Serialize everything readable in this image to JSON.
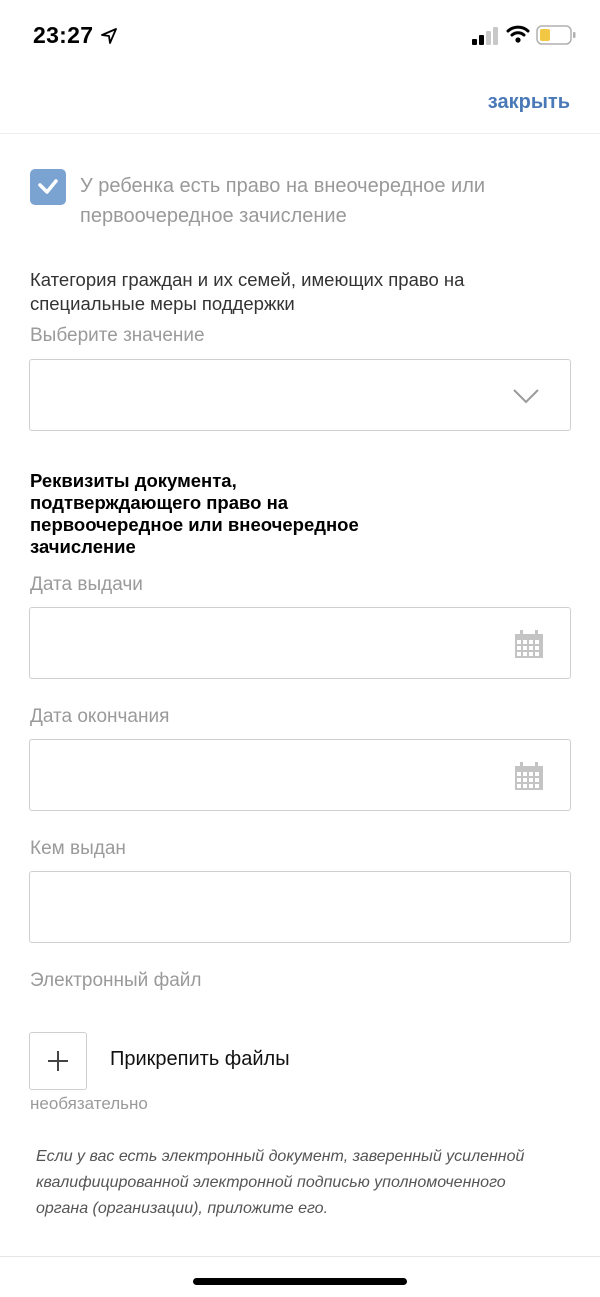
{
  "status_bar": {
    "time": "23:27",
    "icons": [
      "location-arrow-icon",
      "cellular-signal-icon",
      "wifi-icon",
      "battery-icon"
    ],
    "battery_color": "#f2c744"
  },
  "header": {
    "close_label": "закрыть",
    "accent_color": "#4a79b8"
  },
  "form": {
    "priority_checkbox": {
      "checked": true,
      "label": "У ребенка есть право на внеочередное или первоочередное зачисление",
      "color": "#7aa3d2"
    },
    "category": {
      "label": "Категория граждан и их семей, имеющих право на специальные меры поддержки",
      "placeholder": "Выберите значение",
      "value": ""
    },
    "document_section_title": "Реквизиты документа, подтверждающего право на первоочередное или внеочередное зачисление",
    "issue_date": {
      "label": "Дата выдачи",
      "value": ""
    },
    "end_date": {
      "label": "Дата окончания",
      "value": ""
    },
    "issued_by": {
      "label": "Кем выдан",
      "value": ""
    },
    "electronic_file": {
      "label": "Электронный файл",
      "attach_label": "Прикрепить файлы",
      "optional_label": "необязательно",
      "hint": "Если у вас есть электронный документ, заверенный усиленной квалифицированной электронной подписью уполномоченного органа (организации), приложите его."
    }
  }
}
